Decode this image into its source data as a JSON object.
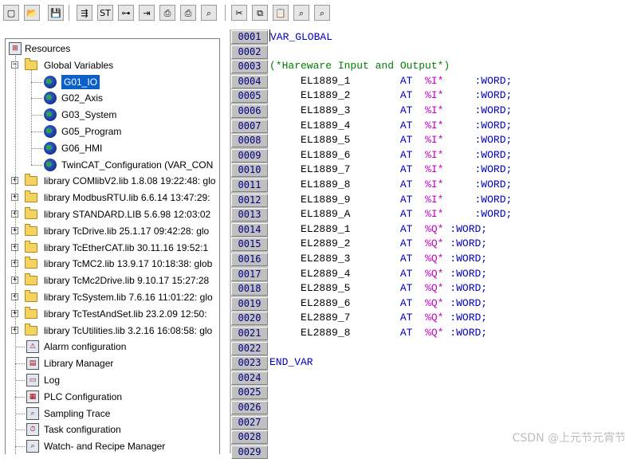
{
  "toolbar": {
    "buttons": [
      {
        "name": "new-file-icon",
        "glyph": "▢"
      },
      {
        "name": "open-folder-icon",
        "glyph": "📂"
      },
      {
        "name": "save-icon",
        "glyph": "💾"
      },
      {
        "name": "build-icon",
        "glyph": "⇶"
      },
      {
        "name": "stop-icon",
        "glyph": "ST"
      },
      {
        "name": "step-icon",
        "glyph": "⊶"
      },
      {
        "name": "breakpoint-icon",
        "glyph": "⇥"
      },
      {
        "name": "print-icon",
        "glyph": "⎙"
      },
      {
        "name": "run-print-icon",
        "glyph": "⎙"
      },
      {
        "name": "find-icon",
        "glyph": "⌕"
      },
      {
        "name": "cut-icon",
        "glyph": "✂"
      },
      {
        "name": "copy-icon",
        "glyph": "⧉"
      },
      {
        "name": "paste-icon",
        "glyph": "📋"
      },
      {
        "name": "find-replace-icon",
        "glyph": "⌕"
      },
      {
        "name": "find-next-icon",
        "glyph": "⌕"
      }
    ]
  },
  "tree": {
    "root": "Resources",
    "global_variables": "Global Variables",
    "gv_items": [
      "G01_IO",
      "G02_Axis",
      "G03_System",
      "G05_Program",
      "G06_HMI",
      "TwinCAT_Configuration (VAR_CON"
    ],
    "selected": "G01_IO",
    "libraries": [
      "library COMlibV2.lib 1.8.08 19:22:48: glo",
      "library ModbusRTU.lib 6.6.14 13:47:29:",
      "library STANDARD.LIB 5.6.98 12:03:02",
      "library TcDrive.lib 25.1.17 09:42:28: glo",
      "library TcEtherCAT.lib 30.11.16 19:52:1",
      "library TcMC2.lib 13.9.17 10:18:38: glob",
      "library TcMc2Drive.lib 9.10.17 15:27:28",
      "library TcSystem.lib 7.6.16 11:01:22: glo",
      "library TcTestAndSet.lib 23.2.09 12:50:",
      "library TcUtilities.lib 3.2.16 16:08:58: glo"
    ],
    "resources": [
      {
        "label": "Alarm configuration",
        "icon": "alarm-icon"
      },
      {
        "label": "Library Manager",
        "icon": "library-manager-icon"
      },
      {
        "label": "Log",
        "icon": "log-icon"
      },
      {
        "label": "PLC Configuration",
        "icon": "plc-configuration-icon"
      },
      {
        "label": "Sampling Trace",
        "icon": "sampling-trace-icon"
      },
      {
        "label": "Task configuration",
        "icon": "task-configuration-icon"
      },
      {
        "label": "Watch- and Recipe Manager",
        "icon": "watch-recipe-icon"
      }
    ]
  },
  "editor": {
    "line_numbers": [
      "0001",
      "0002",
      "0003",
      "0004",
      "0005",
      "0006",
      "0007",
      "0008",
      "0009",
      "0010",
      "0011",
      "0012",
      "0013",
      "0014",
      "0015",
      "0016",
      "0017",
      "0018",
      "0019",
      "0020",
      "0021",
      "0022",
      "0023",
      "0024",
      "0025",
      "0026",
      "0027",
      "0028",
      "0029"
    ],
    "header": "VAR_GLOBAL",
    "comment": "(*Hareware Input and Output*)",
    "inputs": [
      "EL1889_1",
      "EL1889_2",
      "EL1889_3",
      "EL1889_4",
      "EL1889_5",
      "EL1889_6",
      "EL1889_7",
      "EL1889_8",
      "EL1889_9",
      "EL1889_A"
    ],
    "outputs": [
      "EL2889_1",
      "EL2889_2",
      "EL2889_3",
      "EL2889_4",
      "EL2889_5",
      "EL2889_6",
      "EL2889_7",
      "EL2889_8"
    ],
    "at": "AT",
    "input_addr": "%I*",
    "output_addr": "%Q*",
    "type": ":WORD;",
    "footer": "END_VAR"
  },
  "watermark": "CSDN @上元节元宵节"
}
